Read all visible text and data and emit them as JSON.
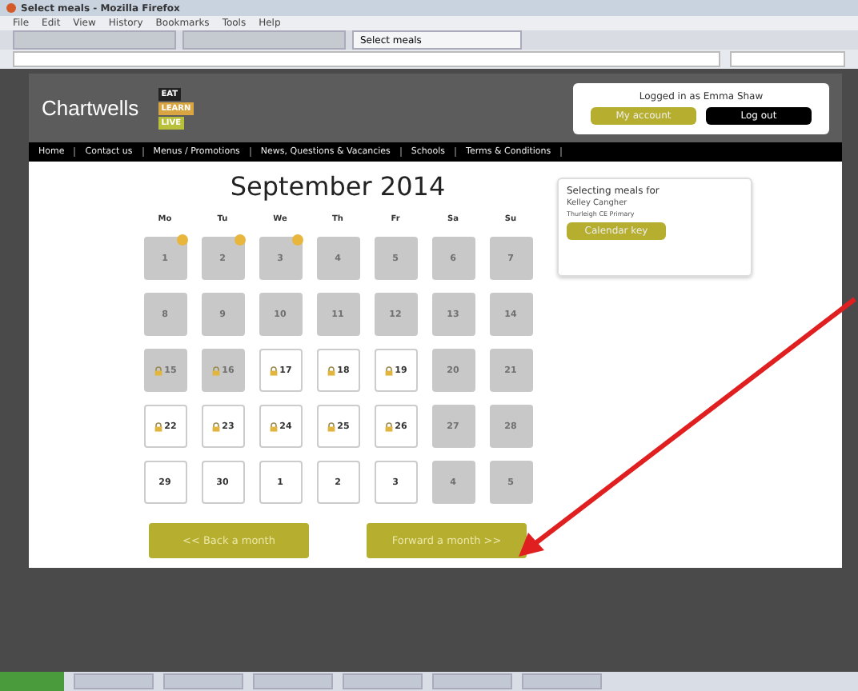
{
  "window": {
    "title": "Select meals - Mozilla Firefox"
  },
  "menu": [
    "File",
    "Edit",
    "View",
    "History",
    "Bookmarks",
    "Tools",
    "Help"
  ],
  "tabs": [
    {
      "label": "Select meals",
      "selected": true
    }
  ],
  "header": {
    "logo": "Chartwells",
    "badges": [
      "EAT",
      "LEARN",
      "LIVE"
    ],
    "logged_in": "Logged in as Emma Shaw",
    "account_button": "My account",
    "logout_button": "Log out"
  },
  "nav": [
    "Home",
    "Contact us",
    "Menus / Promotions",
    "News, Questions & Vacancies",
    "Schools",
    "Terms & Conditions"
  ],
  "calendar": {
    "title": "September 2014",
    "weekdays": [
      "Mo",
      "Tu",
      "We",
      "Th",
      "Fr",
      "Sa",
      "Su"
    ],
    "weeks": [
      [
        {
          "day": "1",
          "kind": "sun"
        },
        {
          "day": "2",
          "kind": "sun"
        },
        {
          "day": "3",
          "kind": "sun"
        },
        {
          "day": "4",
          "kind": "grey"
        },
        {
          "day": "5",
          "kind": "grey"
        },
        {
          "day": "6",
          "kind": "grey"
        },
        {
          "day": "7",
          "kind": "grey"
        }
      ],
      [
        {
          "day": "8",
          "kind": "grey"
        },
        {
          "day": "9",
          "kind": "grey"
        },
        {
          "day": "10",
          "kind": "grey"
        },
        {
          "day": "11",
          "kind": "grey"
        },
        {
          "day": "12",
          "kind": "grey"
        },
        {
          "day": "13",
          "kind": "grey"
        },
        {
          "day": "14",
          "kind": "grey"
        }
      ],
      [
        {
          "day": "15",
          "kind": "greylock"
        },
        {
          "day": "16",
          "kind": "greylock"
        },
        {
          "day": "17",
          "kind": "lock"
        },
        {
          "day": "18",
          "kind": "lock"
        },
        {
          "day": "19",
          "kind": "lock"
        },
        {
          "day": "20",
          "kind": "grey"
        },
        {
          "day": "21",
          "kind": "grey"
        }
      ],
      [
        {
          "day": "22",
          "kind": "lock"
        },
        {
          "day": "23",
          "kind": "lock"
        },
        {
          "day": "24",
          "kind": "lock"
        },
        {
          "day": "25",
          "kind": "lock"
        },
        {
          "day": "26",
          "kind": "lock"
        },
        {
          "day": "27",
          "kind": "grey"
        },
        {
          "day": "28",
          "kind": "grey"
        }
      ],
      [
        {
          "day": "29",
          "kind": "open"
        },
        {
          "day": "30",
          "kind": "open"
        },
        {
          "day": "1",
          "kind": "open"
        },
        {
          "day": "2",
          "kind": "open"
        },
        {
          "day": "3",
          "kind": "open"
        },
        {
          "day": "4",
          "kind": "grey"
        },
        {
          "day": "5",
          "kind": "grey"
        }
      ]
    ],
    "back_button": "<< Back a month",
    "forward_button": "Forward a month >>"
  },
  "side_panel": {
    "heading": "Selecting meals for",
    "pupil": "Kelley Cangher",
    "school": "Thurleigh CE Primary",
    "key_button": "Calendar key"
  }
}
